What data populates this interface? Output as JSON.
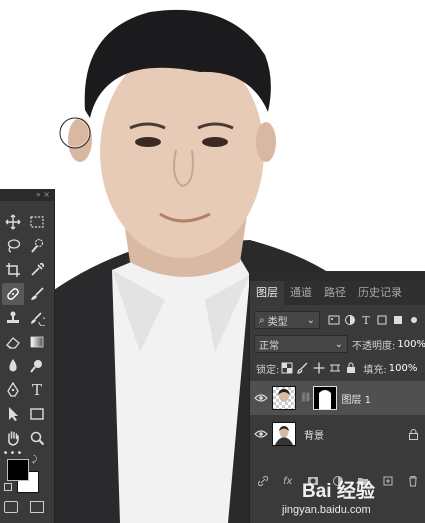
{
  "panel": {
    "tabs": [
      "图层",
      "通道",
      "路径",
      "历史记录"
    ],
    "active_tab": "图层",
    "filter_label": "类型",
    "blend_mode": "正常",
    "opacity_label": "不透明度:",
    "opacity_value": "100%",
    "lock_label": "锁定:",
    "fill_label": "填充:",
    "fill_value": "100%",
    "layers": [
      {
        "name": "图层 1",
        "selected": true,
        "has_mask": true
      },
      {
        "name": "背景",
        "selected": false,
        "locked": true
      }
    ],
    "bottom_icons": [
      "link-icon",
      "fx-icon",
      "mask-icon",
      "adjustment-icon",
      "folder-icon",
      "new-layer-icon",
      "trash-icon"
    ],
    "bottom_fx_label": "fx"
  },
  "toolbox": {
    "tools": [
      "move-icon",
      "marquee-icon",
      "lasso-icon",
      "quick-select-icon",
      "crop-icon",
      "eyedropper-icon",
      "healing-icon",
      "brush-icon",
      "stamp-icon",
      "history-brush-icon",
      "eraser-icon",
      "gradient-icon",
      "blur-icon",
      "dodge-icon",
      "pen-icon",
      "type-icon",
      "path-select-icon",
      "shape-icon",
      "hand-icon",
      "zoom-icon"
    ],
    "type_glyph": "T",
    "foreground_color": "#000000",
    "background_color": "#ffffff"
  },
  "watermark": {
    "brand": "Bai 经验",
    "url": "jingyan.baidu.com"
  }
}
